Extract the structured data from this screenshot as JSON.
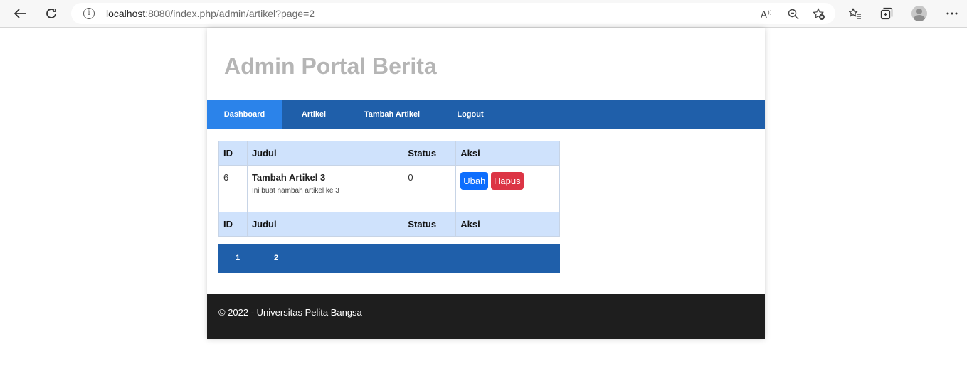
{
  "browser": {
    "url_host": "localhost",
    "url_rest": ":8080/index.php/admin/artikel?page=2"
  },
  "site": {
    "title": "Admin Portal Berita"
  },
  "nav": {
    "items": [
      {
        "label": "Dashboard",
        "active": true
      },
      {
        "label": "Artikel",
        "active": false
      },
      {
        "label": "Tambah Artikel",
        "active": false
      },
      {
        "label": "Logout",
        "active": false
      }
    ]
  },
  "table": {
    "headers": [
      "ID",
      "Judul",
      "Status",
      "Aksi"
    ],
    "rows": [
      {
        "id": "6",
        "judul": "Tambah Artikel 3",
        "deskripsi": "Ini buat nambah artikel ke 3",
        "status": "0",
        "edit_label": "Ubah",
        "delete_label": "Hapus"
      }
    ],
    "footer_headers": [
      "ID",
      "Judul",
      "Status",
      "Aksi"
    ]
  },
  "pagination": {
    "pages": [
      "1",
      "2"
    ]
  },
  "footer": {
    "text": "© 2022 - Universitas Pelita Bangsa"
  },
  "colors": {
    "navbar": "#1f5faa",
    "nav_active": "#2b83ea",
    "table_header": "#cfe2fc",
    "btn_edit": "#0d6efd",
    "btn_delete": "#dc3545",
    "footer": "#1e1e1e"
  }
}
